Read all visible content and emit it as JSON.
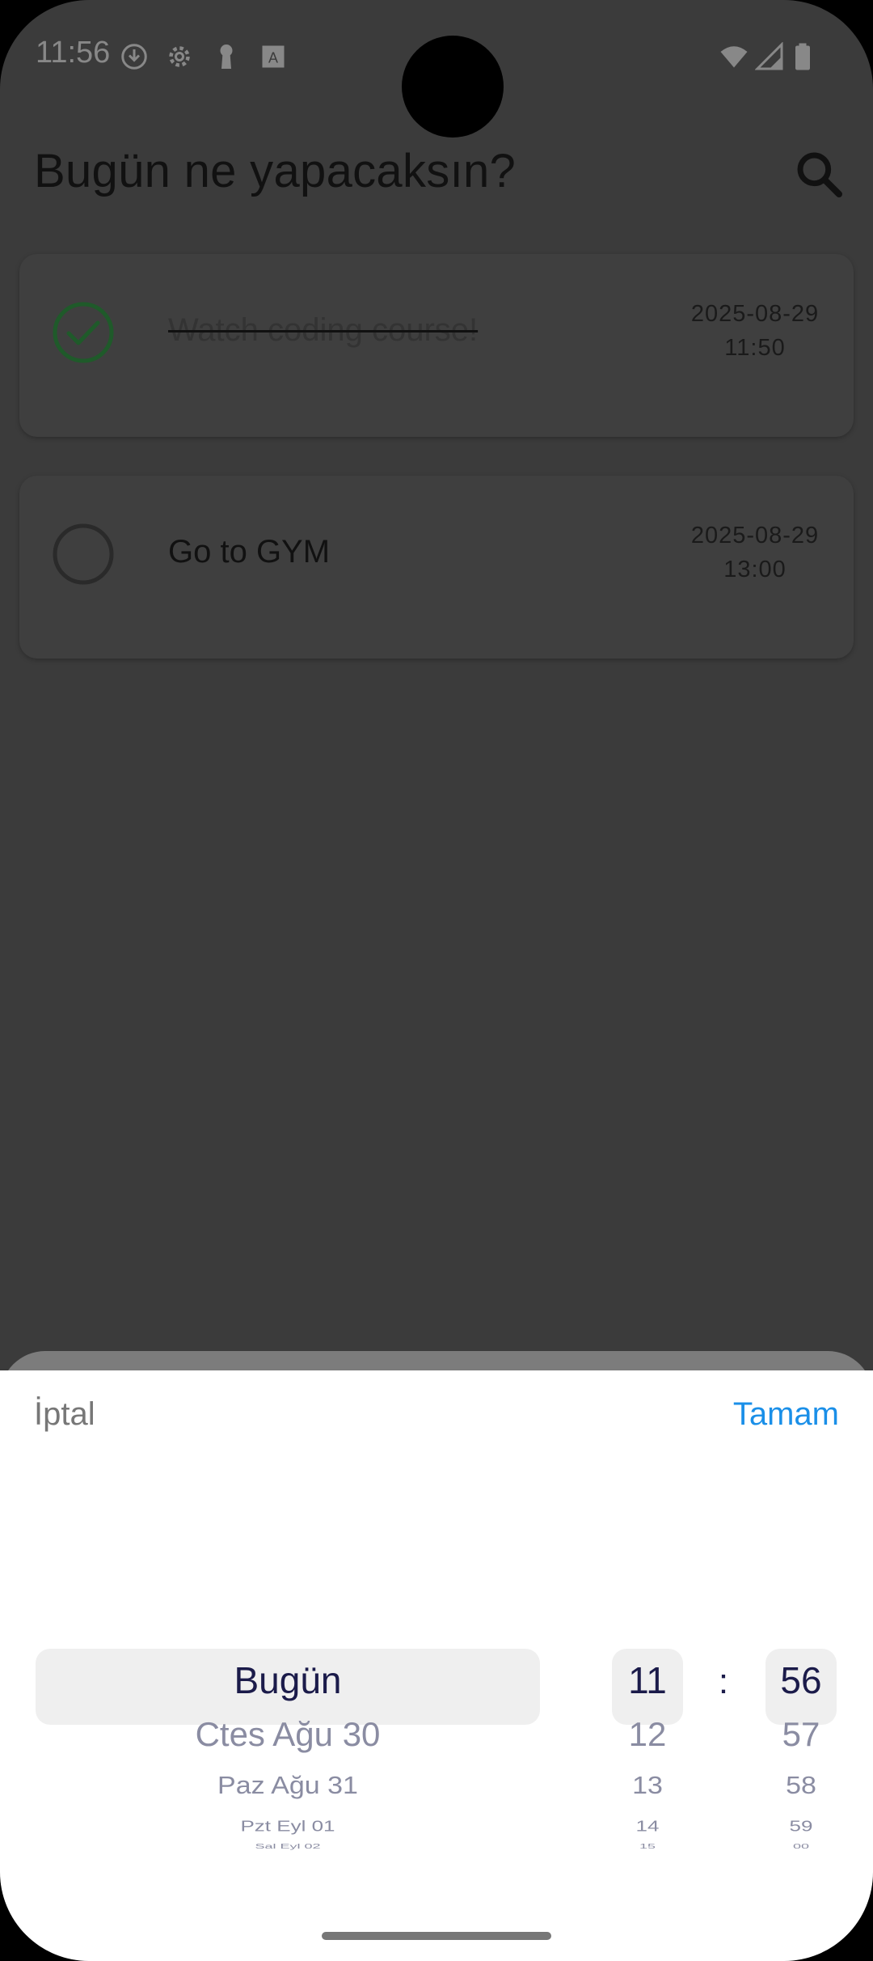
{
  "status_bar": {
    "time": "11:56",
    "icons": [
      "download-icon",
      "settings-icon",
      "keyhole-icon",
      "a-icon",
      "wifi-icon",
      "signal-icon",
      "battery-icon"
    ]
  },
  "app": {
    "title": "Bugün ne yapacaksın?",
    "search_icon": "search-icon"
  },
  "tasks": [
    {
      "text": "Watch coding course!",
      "date": "2025-08-29",
      "time": "11:50",
      "done": true
    },
    {
      "text": "Go to GYM",
      "date": "2025-08-29",
      "time": "13:00",
      "done": false
    }
  ],
  "picker": {
    "cancel_label": "İptal",
    "ok_label": "Tamam",
    "day_options": [
      "Bugün",
      "Ctes Ağu 30",
      "Paz Ağu 31",
      "Pzt Eyl 01",
      "Sal Eyl 02"
    ],
    "hour_options": [
      "11",
      "12",
      "13",
      "14",
      "15"
    ],
    "separator": ":",
    "minute_options": [
      "56",
      "57",
      "58",
      "59",
      "00"
    ]
  },
  "colors": {
    "accent": "#1a8fe8",
    "check_done": "#1f5a2a",
    "overlay_bg": "#3b3b3b"
  }
}
